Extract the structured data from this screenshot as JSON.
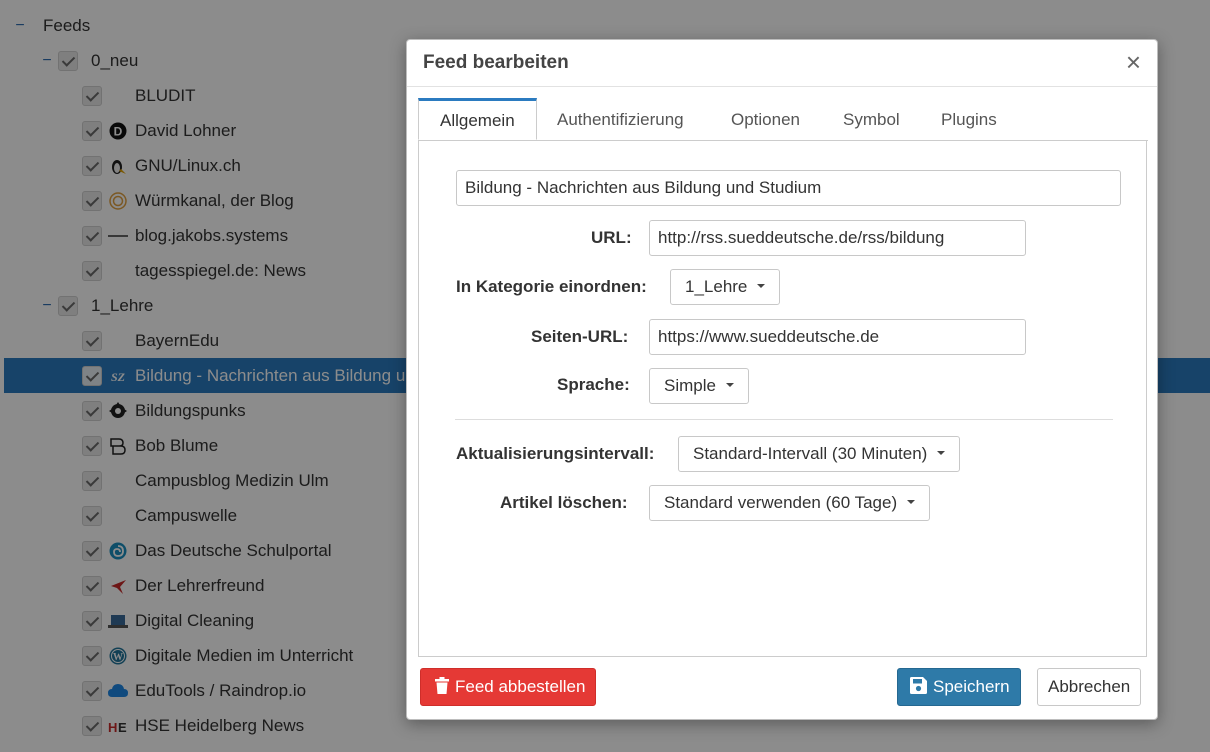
{
  "tree": {
    "root_label": "Feeds",
    "toggle_symbol": "−",
    "categories": [
      {
        "label": "0_neu",
        "feeds": [
          {
            "title": "BLUDIT",
            "icon": "none"
          },
          {
            "title": "David Lohner",
            "icon": "d-circle-icon"
          },
          {
            "title": "GNU/Linux.ch",
            "icon": "penguin-icon"
          },
          {
            "title": "Würmkanal, der Blog",
            "icon": "orange-circle-icon"
          },
          {
            "title": "blog.jakobs.systems",
            "icon": "dash-icon"
          },
          {
            "title": "tagesspiegel.de: News",
            "icon": "none"
          }
        ]
      },
      {
        "label": "1_Lehre",
        "feeds": [
          {
            "title": "BayernEdu",
            "icon": "none"
          },
          {
            "title": "Bildung - Nachrichten aus Bildung und Studium",
            "icon": "sz-icon",
            "selected": true
          },
          {
            "title": "Bildungspunks",
            "icon": "gear-face-icon"
          },
          {
            "title": "Bob Blume",
            "icon": "bb-icon"
          },
          {
            "title": "Campusblog Medizin Ulm",
            "icon": "none"
          },
          {
            "title": "Campuswelle",
            "icon": "none"
          },
          {
            "title": "Das Deutsche Schulportal",
            "icon": "swirl-icon"
          },
          {
            "title": "Der Lehrerfreund",
            "icon": "arrow-icon"
          },
          {
            "title": "Digital Cleaning",
            "icon": "laptop-icon"
          },
          {
            "title": "Digitale Medien im Unterricht",
            "icon": "wordpress-icon"
          },
          {
            "title": "EduTools / Raindrop.io",
            "icon": "cloud-icon"
          },
          {
            "title": "HSE Heidelberg News",
            "icon": "hse-icon"
          }
        ]
      }
    ]
  },
  "dialog": {
    "title": "Feed bearbeiten",
    "close_symbol": "×",
    "tabs": [
      {
        "label": "Allgemein",
        "active": true
      },
      {
        "label": "Authentifizierung"
      },
      {
        "label": "Optionen"
      },
      {
        "label": "Symbol"
      },
      {
        "label": "Plugins"
      }
    ],
    "form": {
      "feed_title": "Bildung - Nachrichten aus Bildung und Studium",
      "url_label": "URL:",
      "url_value": "http://rss.sueddeutsche.de/rss/bildung",
      "category_label": "In Kategorie einordnen:",
      "category_value": "1_Lehre",
      "site_url_label": "Seiten-URL:",
      "site_url_value": "https://www.sueddeutsche.de",
      "language_label": "Sprache:",
      "language_value": "Simple",
      "update_interval_label": "Aktualisierungsintervall:",
      "update_interval_value": "Standard-Intervall (30 Minuten)",
      "purge_label": "Artikel löschen:",
      "purge_value": "Standard verwenden (60 Tage)"
    },
    "buttons": {
      "unsubscribe": "Feed abbestellen",
      "save": "Speichern",
      "cancel": "Abbrechen"
    }
  },
  "colors": {
    "selected_row": "#2b7bc0",
    "danger": "#e53935",
    "primary": "#2e7aa8",
    "overlay": "rgba(0,0,0,0.45)"
  }
}
